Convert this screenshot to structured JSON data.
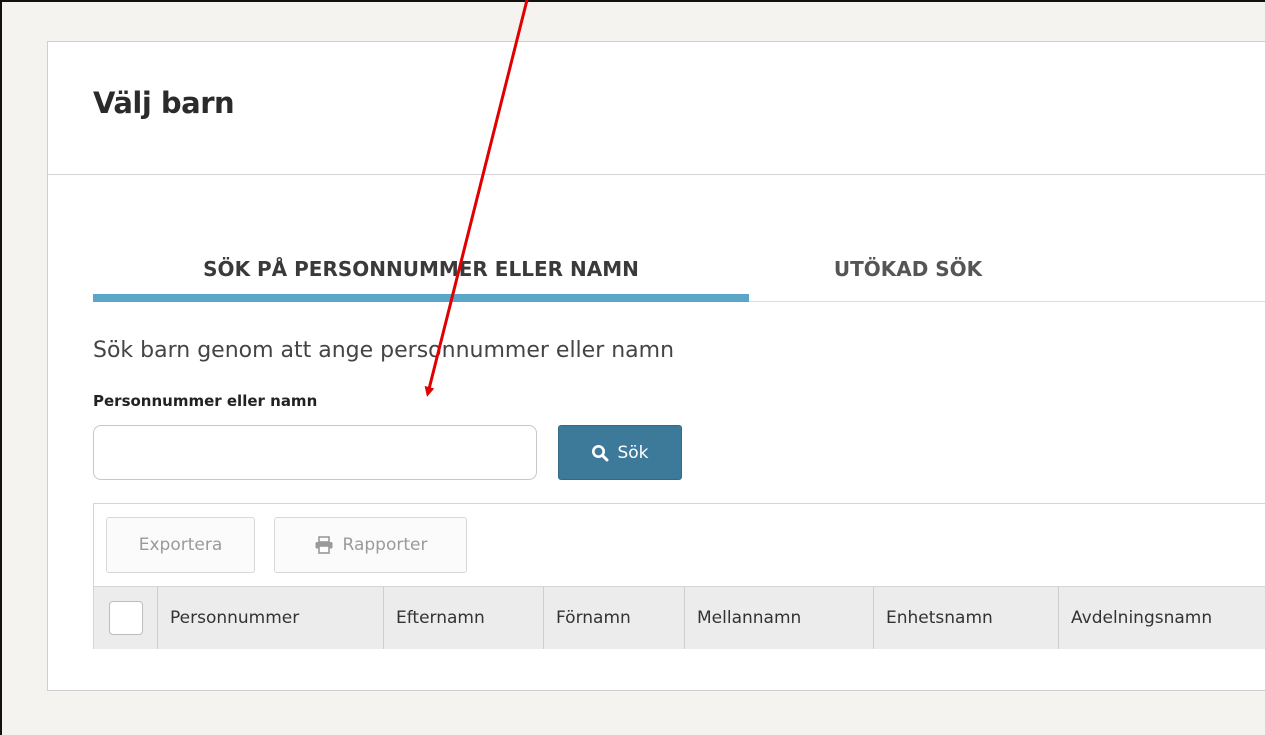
{
  "header": {
    "title": "Välj barn"
  },
  "tabs": [
    {
      "label": "SÖK PÅ PERSONNUMMER ELLER NAMN",
      "active": true
    },
    {
      "label": "UTÖKAD SÖK",
      "active": false
    }
  ],
  "search": {
    "intro": "Sök barn genom att ange personnummer eller namn",
    "label": "Personnummer eller namn",
    "value": "",
    "placeholder": "",
    "button_label": "Sök",
    "button_icon": "search-icon"
  },
  "toolbar": {
    "export_label": "Exportera",
    "report_label": "Rapporter",
    "report_icon": "printer-icon"
  },
  "grid": {
    "columns": [
      "Personnummer",
      "Efternamn",
      "Förnamn",
      "Mellannamn",
      "Enhetsnamn",
      "Avdelningsnamn"
    ]
  },
  "colors": {
    "accent": "#5aa5c8",
    "button": "#3d7a99",
    "annotation_arrow": "#e00000"
  }
}
